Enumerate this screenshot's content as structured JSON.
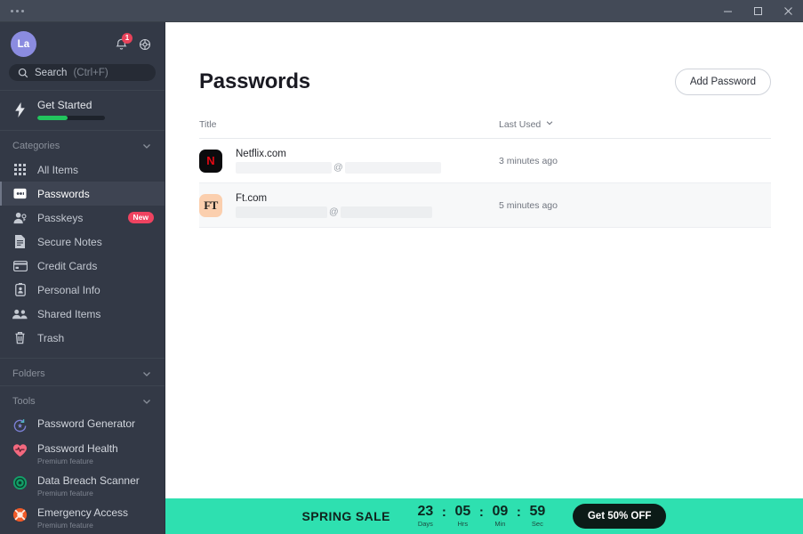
{
  "titlebar": {
    "menu_icon": "more-horizontal-icon",
    "minimize_label": "─",
    "maximize_label": "□",
    "close_label": "✕"
  },
  "sidebar": {
    "avatar_initials": "La",
    "notification_icon": "bell-icon",
    "notification_count": "1",
    "settings_icon": "gear-icon",
    "search": {
      "icon": "search-icon",
      "label": "Search",
      "hint": "(Ctrl+F)"
    },
    "get_started": {
      "icon": "lightning-icon",
      "label": "Get Started",
      "progress": 45
    },
    "categories": {
      "header": "Categories",
      "chevron_icon": "chevron-down-icon",
      "items": [
        {
          "label": "All Items",
          "icon": "grid-icon",
          "active": false,
          "badge": ""
        },
        {
          "label": "Passwords",
          "icon": "card-key-icon",
          "active": true,
          "badge": ""
        },
        {
          "label": "Passkeys",
          "icon": "person-key-icon",
          "active": false,
          "badge": "New"
        },
        {
          "label": "Secure Notes",
          "icon": "note-icon",
          "active": false,
          "badge": ""
        },
        {
          "label": "Credit Cards",
          "icon": "credit-card-icon",
          "active": false,
          "badge": ""
        },
        {
          "label": "Personal Info",
          "icon": "id-card-icon",
          "active": false,
          "badge": ""
        },
        {
          "label": "Shared Items",
          "icon": "people-icon",
          "active": false,
          "badge": ""
        },
        {
          "label": "Trash",
          "icon": "trash-icon",
          "active": false,
          "badge": ""
        }
      ]
    },
    "folders": {
      "header": "Folders",
      "chevron_icon": "chevron-down-icon"
    },
    "tools": {
      "header": "Tools",
      "chevron_icon": "chevron-down-icon",
      "items": [
        {
          "label": "Password Generator",
          "sub": "",
          "icon": "refresh-star-icon"
        },
        {
          "label": "Password Health",
          "sub": "Premium feature",
          "icon": "heart-pulse-icon"
        },
        {
          "label": "Data Breach Scanner",
          "sub": "Premium feature",
          "icon": "target-icon"
        },
        {
          "label": "Emergency Access",
          "sub": "Premium feature",
          "icon": "lifebuoy-icon"
        }
      ]
    }
  },
  "main": {
    "title": "Passwords",
    "add_button": "Add Password",
    "columns": {
      "title": "Title",
      "sort": "Last Used",
      "sort_icon": "chevron-down-icon"
    },
    "rows": [
      {
        "title": "Netflix.com",
        "favicon_text": "N",
        "favicon_type": "netflix",
        "username_at": "@",
        "time": "3 minutes ago",
        "hover": false
      },
      {
        "title": "Ft.com",
        "favicon_text": "FT",
        "favicon_type": "ft",
        "username_at": "@",
        "time": "5 minutes ago",
        "hover": true
      }
    ]
  },
  "banner": {
    "sale_label": "SPRING SALE",
    "countdown": [
      {
        "value": "23",
        "label": "Days"
      },
      {
        "value": "05",
        "label": "Hrs"
      },
      {
        "value": "09",
        "label": "Min"
      },
      {
        "value": "59",
        "label": "Sec"
      }
    ],
    "separator": ":",
    "cta": "Get 50% OFF"
  },
  "colors": {
    "accent_green": "#22c55e",
    "banner_teal": "#2ee0b0",
    "badge_red": "#e8425a",
    "avatar_purple": "#8b8ce0",
    "netflix_red": "#e50914",
    "ft_peach": "#fbcfae"
  }
}
